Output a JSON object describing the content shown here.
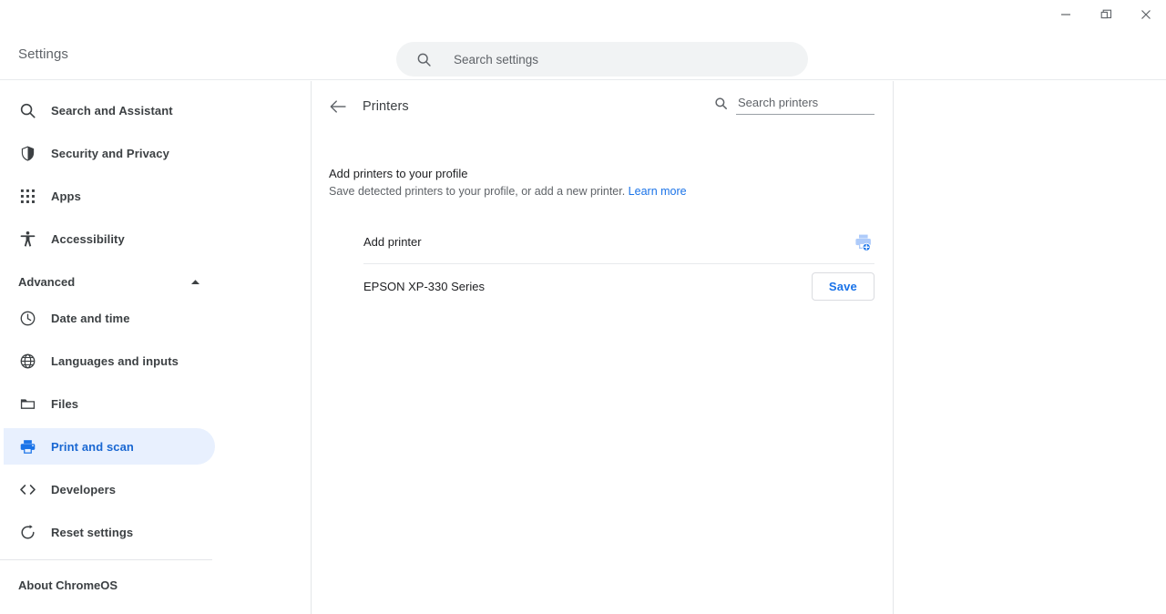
{
  "window": {
    "controls": [
      {
        "name": "minimize",
        "label": "Minimize"
      },
      {
        "name": "restore",
        "label": "Restore"
      },
      {
        "name": "close",
        "label": "Close"
      }
    ]
  },
  "toolbar": {
    "app_title": "Settings",
    "search": {
      "placeholder": "Search settings",
      "value": "",
      "icon": "search-icon"
    }
  },
  "sidebar": {
    "items": [
      {
        "label": "Search and Assistant",
        "icon": "search-icon",
        "selected": false
      },
      {
        "label": "Security and Privacy",
        "icon": "shield-icon",
        "selected": false
      },
      {
        "label": "Apps",
        "icon": "grid-apps-icon",
        "selected": false
      },
      {
        "label": "Accessibility",
        "icon": "accessibility-icon",
        "selected": false
      }
    ],
    "advanced": {
      "label": "Advanced",
      "expanded": true,
      "chevron_icon": "chevron-up-icon",
      "items": [
        {
          "label": "Date and time",
          "icon": "clock-icon",
          "selected": false
        },
        {
          "label": "Languages and inputs",
          "icon": "globe-icon",
          "selected": false
        },
        {
          "label": "Files",
          "icon": "folder-icon",
          "selected": false
        },
        {
          "label": "Print and scan",
          "icon": "printer-icon",
          "selected": true
        },
        {
          "label": "Developers",
          "icon": "code-icon",
          "selected": false
        },
        {
          "label": "Reset settings",
          "icon": "restore-icon",
          "selected": false
        }
      ]
    },
    "about": {
      "label": "About ChromeOS"
    }
  },
  "main": {
    "back_icon": "arrow-left-icon",
    "title": "Printers",
    "printer_search": {
      "placeholder": "Search printers",
      "value": "",
      "icon": "search-icon"
    },
    "section": {
      "title": "Add printers to your profile",
      "subtitle": "Save detected printers to your profile, or add a new printer.",
      "link_label": "Learn more"
    },
    "rows": [
      {
        "label": "Add printer",
        "action_type": "icon",
        "action_icon": "add-printer-icon",
        "action_label": ""
      },
      {
        "label": "EPSON XP-330 Series",
        "action_type": "button",
        "action_icon": "",
        "action_label": "Save"
      }
    ]
  },
  "colors": {
    "accent": "#1a73e8",
    "selected_bg": "#e8f0fe",
    "selected_text": "#1967d2",
    "text_primary": "#202124",
    "text_secondary": "#5f6368",
    "divider": "#e4e6e9",
    "add_printer_icon": "#aecbfa"
  }
}
